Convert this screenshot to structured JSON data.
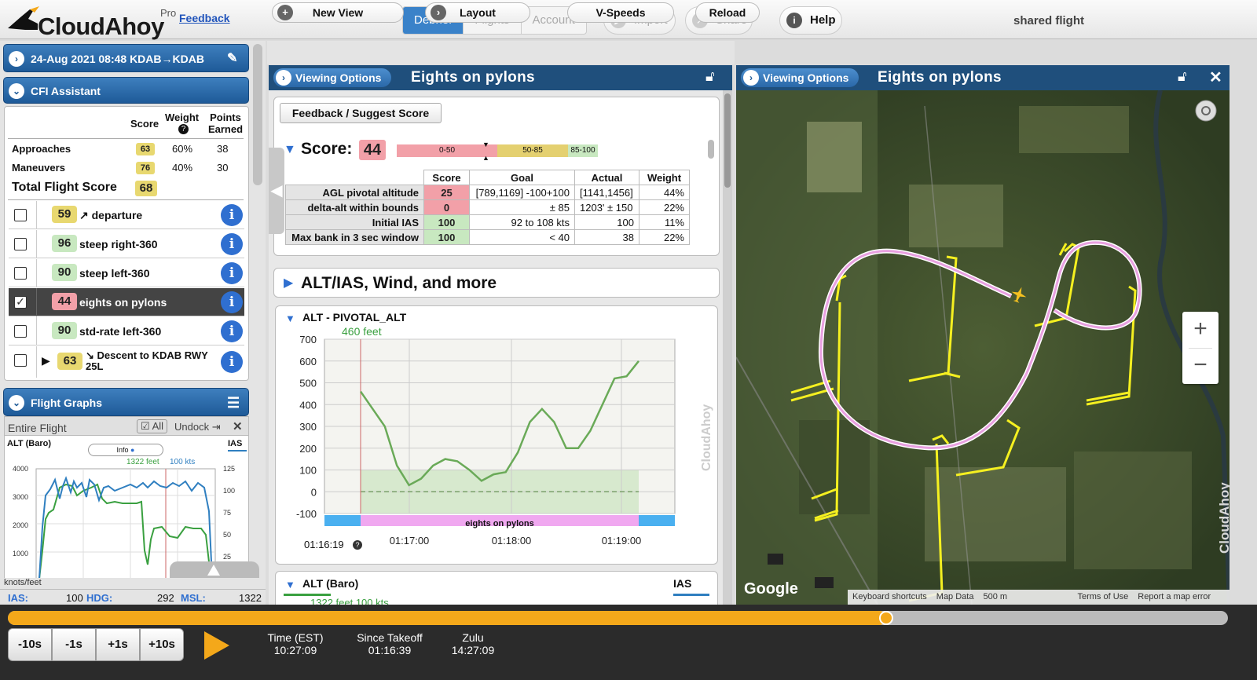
{
  "app": {
    "name": "CloudAhoy",
    "tier": "Pro",
    "feedback": "Feedback",
    "shared": "shared flight"
  },
  "nav": {
    "tabs": [
      "Debrief",
      "Flights",
      "Account"
    ],
    "import": "Import",
    "share": "Share",
    "help": "Help"
  },
  "flight": {
    "title": "24-Aug 2021 08:48 KDAB→KDAB"
  },
  "cfi": {
    "title": "CFI Assistant",
    "headers": {
      "score": "Score",
      "weight": "Weight",
      "points": "Points Earned"
    },
    "summary": [
      {
        "label": "Approaches",
        "score": "63",
        "weight": "60%",
        "points": "38"
      },
      {
        "label": "Maneuvers",
        "score": "76",
        "weight": "40%",
        "points": "30"
      }
    ],
    "total_label": "Total Flight Score",
    "total": "68",
    "maneuvers": [
      {
        "score": "59",
        "label": "↗ departure",
        "checked": false
      },
      {
        "score": "96",
        "label": "steep right-360",
        "checked": false
      },
      {
        "score": "90",
        "label": "steep left-360",
        "checked": false
      },
      {
        "score": "44",
        "label": "eights on pylons",
        "checked": true
      },
      {
        "score": "90",
        "label": "std-rate left-360",
        "checked": false
      },
      {
        "score": "63",
        "label": "↘ Descent to KDAB RWY 25L",
        "checked": false
      }
    ]
  },
  "graphs": {
    "title": "Flight Graphs",
    "range": "Entire Flight",
    "all": "All",
    "undock": "Undock",
    "left_label": "ALT (Baro)",
    "right_label": "IAS",
    "info": "Info",
    "readout_alt": "1322 feet",
    "readout_ias": "100 kts",
    "yleft": [
      "4000",
      "3000",
      "2000",
      "1000"
    ],
    "yright": [
      "125",
      "100",
      "75",
      "50",
      "25"
    ],
    "units": "knots/feet"
  },
  "status": {
    "ias_label": "IAS:",
    "ias": "100",
    "hdg_label": "HDG:",
    "hdg": "292",
    "msl_label": "MSL:",
    "msl": "1322"
  },
  "toolbar": {
    "new_view": "New View",
    "layout": "Layout",
    "vspeeds": "V-Speeds",
    "reload": "Reload"
  },
  "pane": {
    "viewing": "Viewing Options",
    "title": "Eights on pylons"
  },
  "score": {
    "feedback_btn": "Feedback / Suggest Score",
    "label": "Score:",
    "value": "44",
    "bands": [
      "0-50",
      "50-85",
      "85-100"
    ],
    "headers": [
      "Score",
      "Goal",
      "Actual",
      "Weight"
    ],
    "rows": [
      {
        "name": "AGL pivotal altitude",
        "score": "25",
        "goal": "[789,1169] -100+100",
        "actual": "[1141,1456]",
        "weight": "44%"
      },
      {
        "name": "delta-alt within bounds",
        "score": "0",
        "goal": "± 85",
        "actual": "1203' ± 150",
        "weight": "22%"
      },
      {
        "name": "Initial IAS",
        "score": "100",
        "goal": "92 to 108 kts",
        "actual": "100",
        "weight": "11%"
      },
      {
        "name": "Max bank in 3 sec window",
        "score": "100",
        "goal": "< 40",
        "actual": "38",
        "weight": "22%"
      }
    ]
  },
  "more": "ALT/IAS, Wind, and more",
  "chart": {
    "title": "ALT - PIVOTAL_ALT",
    "readout": "460 feet",
    "bar_label": "eights on pylons",
    "clock_time": "01:16:19",
    "watermark": "CloudAhoy"
  },
  "chart_data": {
    "type": "line",
    "yticks": [
      "700",
      "600",
      "500",
      "400",
      "300",
      "200",
      "100",
      "0",
      "-100"
    ],
    "xticks": [
      "01:17:00",
      "01:18:00",
      "01:19:00"
    ],
    "ylim": [
      -100,
      700
    ],
    "series": [
      {
        "values": [
          460,
          380,
          300,
          120,
          30,
          60,
          120,
          150,
          140,
          100,
          50,
          80,
          90,
          180,
          320,
          380,
          320,
          200,
          200,
          280,
          400,
          520,
          530,
          600
        ]
      }
    ]
  },
  "altbaro": {
    "title": "ALT (Baro)",
    "ias": "IAS",
    "readout": "1322 feet   100 kts"
  },
  "map": {
    "google": "Google",
    "footer": [
      "Keyboard shortcuts",
      "Map Data",
      "500 m",
      "Terms of Use",
      "Report a map error"
    ],
    "watermark": "CloudAhoy",
    "zoom_in": "+",
    "zoom_out": "−"
  },
  "playback": {
    "steps": [
      "-10s",
      "-1s",
      "+1s",
      "+10s"
    ],
    "progress": 0.72,
    "time_est_label": "Time (EST)",
    "time_est": "10:27:09",
    "since_label": "Since Takeoff",
    "since": "01:16:39",
    "zulu_label": "Zulu",
    "zulu": "14:27:09"
  },
  "colors": {
    "accent": "#3a82c9",
    "header": "#1f4f7c",
    "timeline": "#f4a81a",
    "path": "#e8a0e0",
    "pylon": "#f5f020"
  }
}
